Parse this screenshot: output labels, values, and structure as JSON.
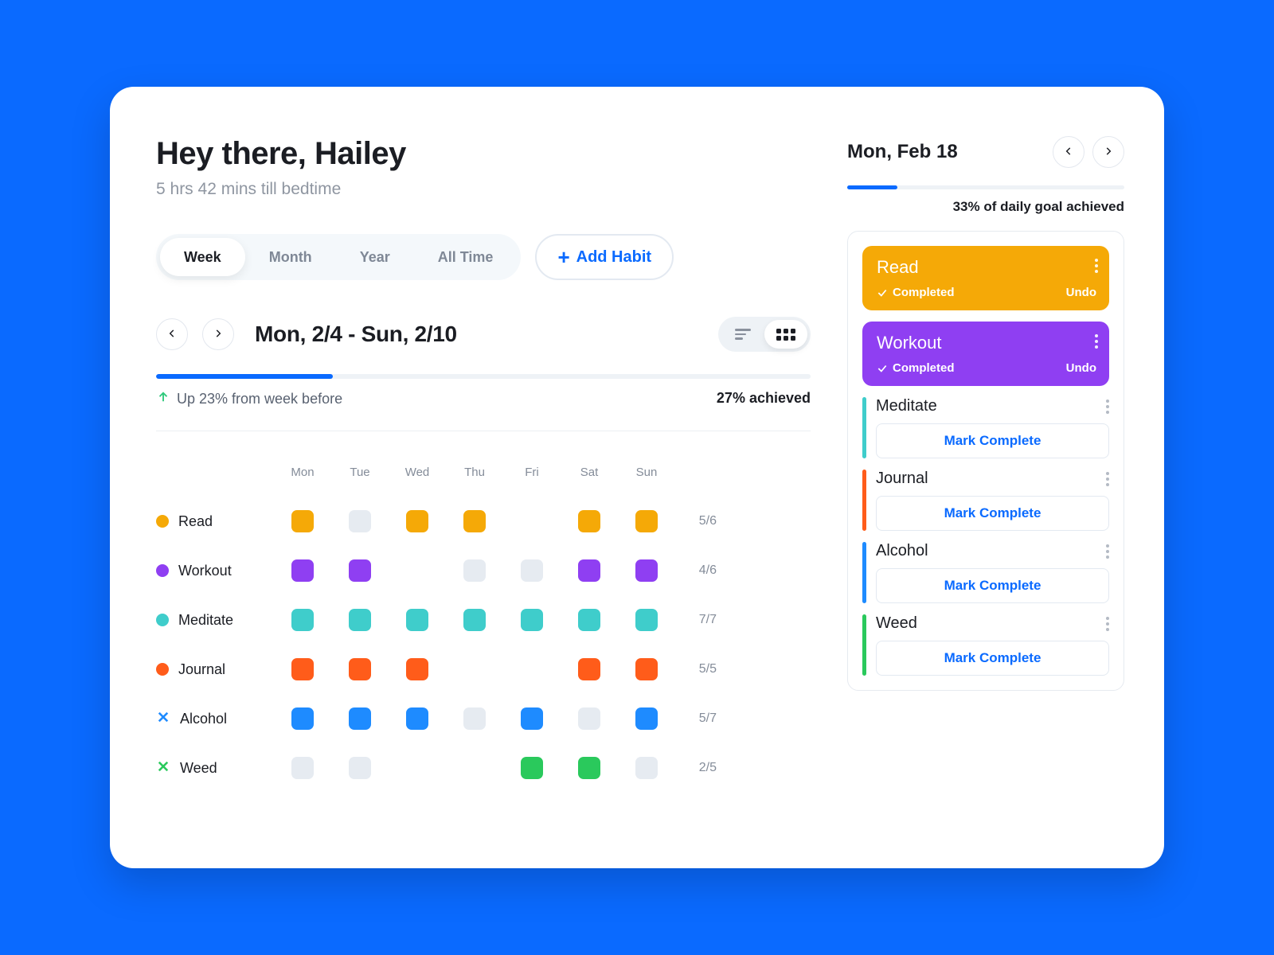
{
  "header": {
    "greeting": "Hey there, Hailey",
    "subtitle": "5 hrs 42 mins till bedtime"
  },
  "tabs": {
    "items": [
      "Week",
      "Month",
      "Year",
      "All Time"
    ],
    "active_index": 0
  },
  "add_habit_label": "Add Habit",
  "range": {
    "title": "Mon, 2/4 - Sun, 2/10",
    "progress_percent": 27,
    "trend_text": "Up 23% from week before",
    "achieved_text": "27% achieved"
  },
  "days": [
    "Mon",
    "Tue",
    "Wed",
    "Thu",
    "Fri",
    "Sat",
    "Sun"
  ],
  "colors": {
    "read": "#F5A907",
    "workout": "#8F3FF2",
    "meditate": "#3FCDCB",
    "journal": "#FF5C1A",
    "alcohol": "#1E8BFF",
    "weed": "#2AC95C",
    "off": "#E6EBF1"
  },
  "habits": [
    {
      "key": "read",
      "name": "Read",
      "icon": "dot",
      "count": "5/6",
      "cells": [
        1,
        0,
        1,
        1,
        null,
        1,
        1
      ]
    },
    {
      "key": "workout",
      "name": "Workout",
      "icon": "dot",
      "count": "4/6",
      "cells": [
        1,
        1,
        null,
        0,
        0,
        1,
        1
      ]
    },
    {
      "key": "meditate",
      "name": "Meditate",
      "icon": "dot",
      "count": "7/7",
      "cells": [
        1,
        1,
        1,
        1,
        1,
        1,
        1
      ]
    },
    {
      "key": "journal",
      "name": "Journal",
      "icon": "dot",
      "count": "5/5",
      "cells": [
        1,
        1,
        1,
        null,
        null,
        1,
        1
      ]
    },
    {
      "key": "alcohol",
      "name": "Alcohol",
      "icon": "x",
      "count": "5/7",
      "cells": [
        1,
        1,
        1,
        0,
        1,
        0,
        1
      ]
    },
    {
      "key": "weed",
      "name": "Weed",
      "icon": "x",
      "count": "2/5",
      "cells": [
        0,
        0,
        null,
        null,
        1,
        1,
        0
      ]
    }
  ],
  "side": {
    "date": "Mon, Feb 18",
    "goal_progress_percent": 18,
    "goal_text": "33% of daily goal achieved",
    "completed": [
      {
        "key": "read",
        "name": "Read",
        "status": "Completed",
        "undo": "Undo"
      },
      {
        "key": "workout",
        "name": "Workout",
        "status": "Completed",
        "undo": "Undo"
      }
    ],
    "pending": [
      {
        "key": "meditate",
        "name": "Meditate",
        "action": "Mark Complete"
      },
      {
        "key": "journal",
        "name": "Journal",
        "action": "Mark Complete"
      },
      {
        "key": "alcohol",
        "name": "Alcohol",
        "action": "Mark Complete"
      },
      {
        "key": "weed",
        "name": "Weed",
        "action": "Mark Complete"
      }
    ]
  }
}
